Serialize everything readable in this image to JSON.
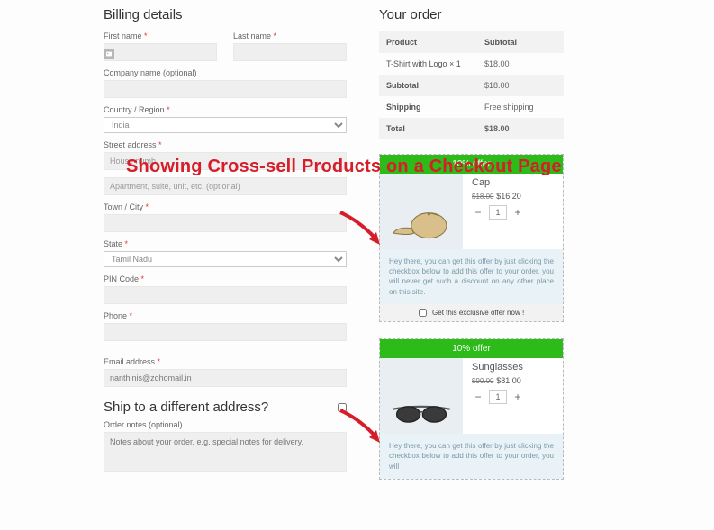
{
  "headline": "Showing Cross-sell Products on a Checkout Page",
  "billing": {
    "title": "Billing details",
    "first_name_label": "First name",
    "last_name_label": "Last name",
    "company_label": "Company name (optional)",
    "country_label": "Country / Region",
    "country_value": "India",
    "street_label": "Street address",
    "street_placeholder": "House numb",
    "street2_placeholder": "Apartment, suite, unit, etc. (optional)",
    "city_label": "Town / City",
    "state_label": "State",
    "state_value": "Tamil Nadu",
    "pin_label": "PIN Code",
    "phone_label": "Phone",
    "email_label": "Email address",
    "email_value": "nanthinis@zohomail.in"
  },
  "ship": {
    "title": "Ship to a different address?",
    "notes_label": "Order notes (optional)",
    "notes_placeholder": "Notes about your order, e.g. special notes for delivery."
  },
  "order": {
    "title": "Your order",
    "product_header": "Product",
    "subtotal_header": "Subtotal",
    "rows": [
      {
        "label": "T-Shirt with Logo  × 1",
        "value": "$18.00"
      },
      {
        "label": "Subtotal",
        "value": "$18.00"
      },
      {
        "label": "Shipping",
        "value": "Free shipping"
      },
      {
        "label": "Total",
        "value": "$18.00"
      }
    ]
  },
  "offers": [
    {
      "banner": "10% offer",
      "name": "Cap",
      "old_price": "$18.00",
      "new_price": "$16.20",
      "qty": "1",
      "desc": "Hey there, you can get this offer by just clicking the checkbox below to add this offer to your order, you will never get such a discount on any other place on this site.",
      "cta": "Get this exclusive offer now !"
    },
    {
      "banner": "10% offer",
      "name": "Sunglasses",
      "old_price": "$90.00",
      "new_price": "$81.00",
      "qty": "1",
      "desc": "Hey there, you can get this offer by just clicking the checkbox below to add this offer to your order, you will",
      "cta": ""
    }
  ]
}
